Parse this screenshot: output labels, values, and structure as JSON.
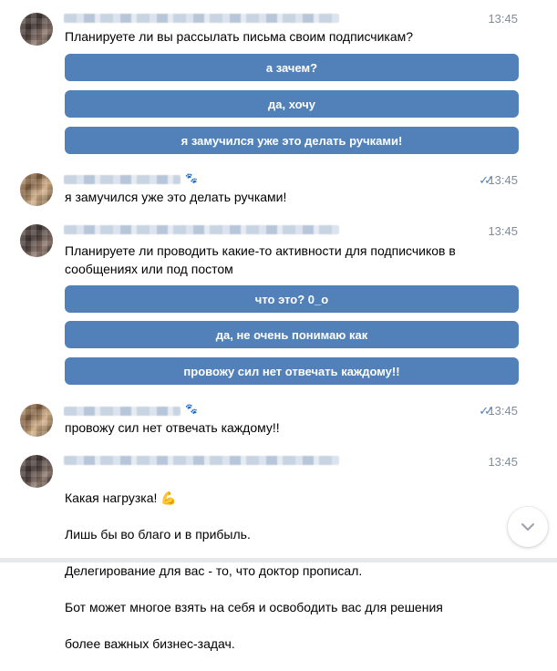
{
  "messages": [
    {
      "sender": "bot",
      "time": "13:45",
      "text": "Планируете ли вы рассылать письма своим подписчикам?",
      "buttons": [
        "а зачем?",
        "да, хочу",
        "я замучился уже это делать ручками!"
      ]
    },
    {
      "sender": "user",
      "time": "13:45",
      "read_icon": "double-check-icon",
      "text": "я замучился уже это делать ручками!"
    },
    {
      "sender": "bot",
      "time": "13:45",
      "text": "Планируете ли проводить какие-то активности для подписчиков в\nсообщениях или под постом",
      "buttons": [
        "что это? 0_о",
        "да, не очень понимаю как",
        "провожу сил нет отвечать каждому!!"
      ]
    },
    {
      "sender": "user",
      "time": "13:45",
      "read_icon": "double-check-icon",
      "text": "провожу сил нет отвечать каждому!!"
    },
    {
      "sender": "bot",
      "time": "13:45",
      "lines": [
        "Какая нагрузка!",
        "Лишь бы во благо и в прибыль.",
        "Делегирование для вас - то, что доктор прописал.",
        "Бот может многое взять на себя и освободить вас для решения",
        "более важных бизнес-задач."
      ],
      "emoji": "💪"
    }
  ],
  "colors": {
    "button": "#5181b8",
    "time": "#818c99",
    "check": "#5181b8"
  },
  "icons": {
    "scroll_down": "chevron-down-icon",
    "sender_badge": "paw-icon"
  }
}
